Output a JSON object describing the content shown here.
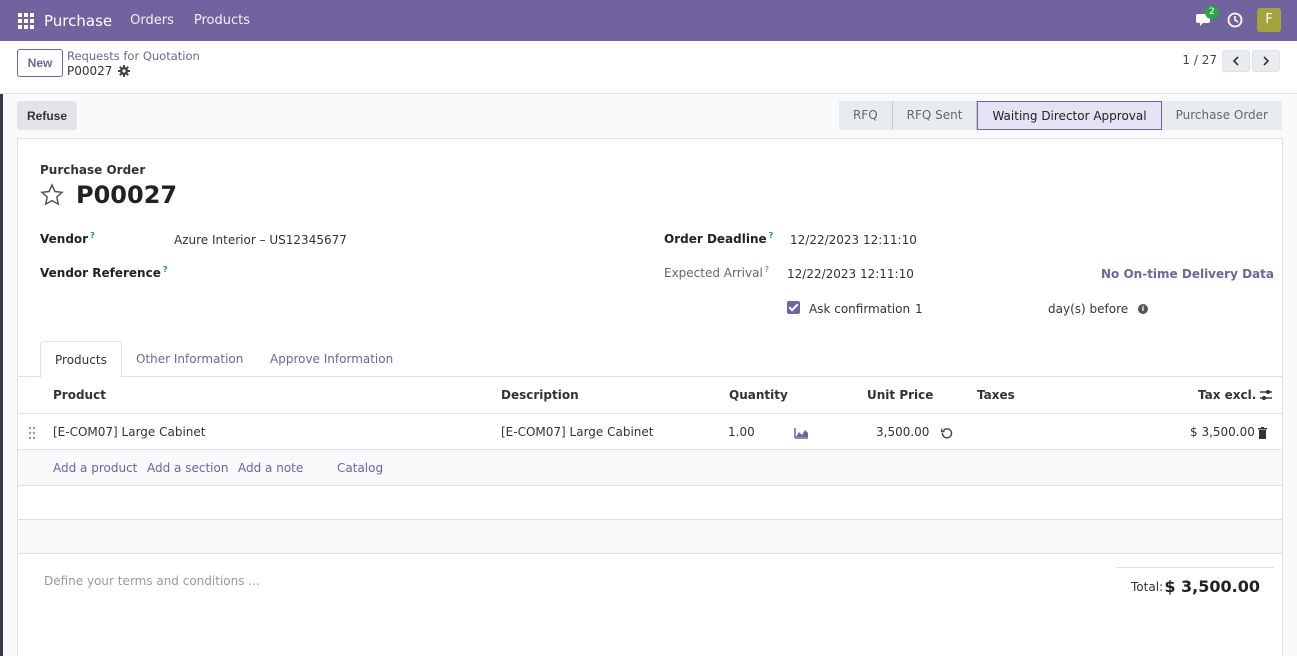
{
  "topbar": {
    "app_title": "Purchase",
    "menu": [
      "Orders",
      "Products"
    ],
    "chat_badge": "2",
    "avatar_initial": "F",
    "colors": {
      "bar": "#71639e",
      "avatar": "#a2a43c",
      "badge": "#28a745"
    }
  },
  "control": {
    "new_label": "New",
    "breadcrumb_parent": "Requests for Quotation",
    "breadcrumb_current": "P00027",
    "pager_value": "1 / 27"
  },
  "statusbar": {
    "refuse_label": "Refuse",
    "stages": [
      "RFQ",
      "RFQ Sent",
      "Waiting Director Approval",
      "Purchase Order"
    ],
    "current_stage": "Waiting Director Approval"
  },
  "form": {
    "doc_type_label": "Purchase Order",
    "title": "P00027",
    "vendor_label": "Vendor",
    "vendor_value": "Azure Interior – US12345677",
    "vendor_ref_label": "Vendor Reference",
    "vendor_ref_value": "",
    "order_deadline_label": "Order Deadline",
    "order_deadline_value": "12/22/2023 12:11:10",
    "expected_arrival_label": "Expected Arrival",
    "expected_arrival_value": "12/22/2023 12:11:10",
    "on_time_link": "No On-time Delivery Data",
    "ask_confirmation_label": "Ask confirmation",
    "ask_confirmation_days": "1",
    "days_before_label": "day(s) before",
    "help_mark": "?"
  },
  "tabs": [
    "Products",
    "Other Information",
    "Approve Information"
  ],
  "table": {
    "headers": {
      "product": "Product",
      "description": "Description",
      "quantity": "Quantity",
      "unit_price": "Unit Price",
      "taxes": "Taxes",
      "tax_excl": "Tax excl."
    },
    "rows": [
      {
        "product": "[E-COM07] Large Cabinet",
        "description": "[E-COM07] Large Cabinet",
        "quantity": "1.00",
        "unit_price": "3,500.00",
        "taxes": "",
        "tax_excl": "$ 3,500.00"
      }
    ],
    "add_links": [
      "Add a product",
      "Add a section",
      "Add a note",
      "Catalog"
    ]
  },
  "footer": {
    "terms_placeholder": "Define your terms and conditions ...",
    "total_label": "Total:",
    "total_value": "$ 3,500.00"
  }
}
